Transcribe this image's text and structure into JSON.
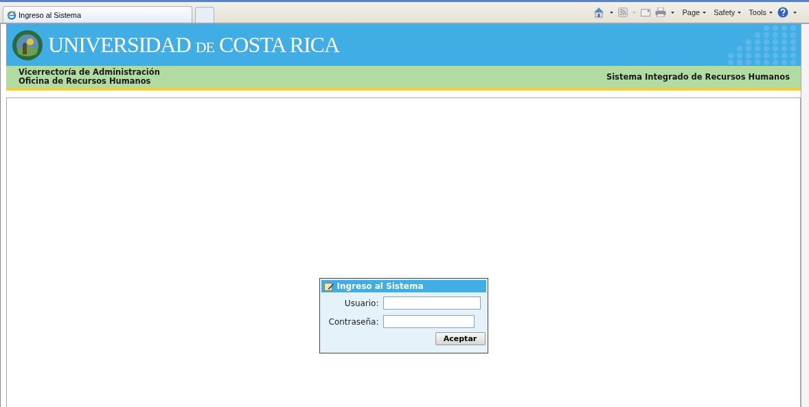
{
  "browser": {
    "tab_title": "Ingreso al Sistema",
    "menus": [
      "Page",
      "Safety",
      "Tools"
    ]
  },
  "header": {
    "logo_text": "UNIVERSIDAD DE COSTA RICA",
    "left_lines": [
      "Vicerrectoría de Administración",
      "Oficina de Recursos Humanos"
    ],
    "right_title": "Sistema Integrado de Recursos Humanos"
  },
  "login": {
    "title": "Ingreso al Sistema",
    "fields": [
      {
        "label": "Usuario:",
        "kind": "text"
      },
      {
        "label": "Contraseña:",
        "kind": "password"
      }
    ],
    "button": "Aceptar"
  }
}
